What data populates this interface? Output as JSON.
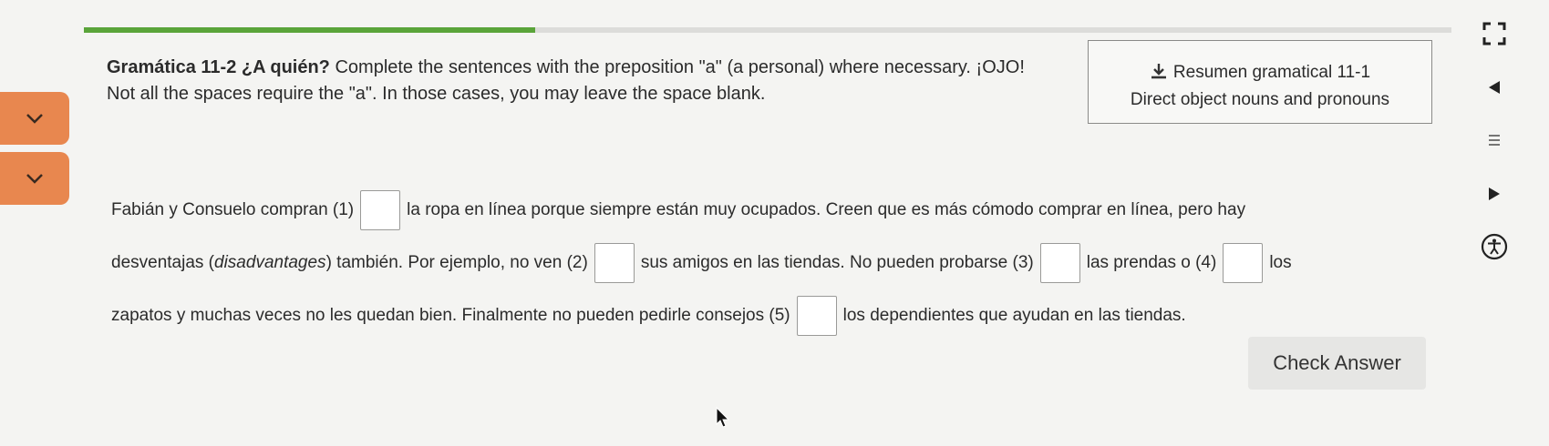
{
  "progress": {
    "value": 0.33,
    "fill_color": "#5aa43a"
  },
  "instructions": {
    "title": "Gramática 11-2 ¿A quién?",
    "line1_rest": " Complete the sentences with the preposition \"a\" (a personal) where necessary. ¡OJO!",
    "line2": "Not all the spaces require the \"a\". In those cases, you may leave the space blank."
  },
  "reference": {
    "icon": "download-icon",
    "line1": "Resumen gramatical 11-1",
    "line2": "Direct object nouns and pronouns"
  },
  "passage": {
    "seg0": "Fabián y Consuelo compran (1)",
    "seg1": "la ropa en línea porque siempre están muy ocupados. Creen que es más cómodo comprar en línea, pero hay",
    "seg2a": "desventajas (",
    "seg2b": "disadvantages",
    "seg2c": ") también. Por ejemplo, no ven (2)",
    "seg3": "sus amigos en las tiendas. No pueden probarse (3)",
    "seg4": "las prendas o (4)",
    "seg5": "los",
    "seg6": "zapatos y muchas veces no les quedan bien. Finalmente no pueden pedirle consejos (5)",
    "seg7": "los dependientes que ayudan en las tiendas."
  },
  "blanks": [
    "",
    "",
    "",
    "",
    ""
  ],
  "check_button": {
    "label": "Check Answer"
  },
  "side_tabs": [
    {
      "icon": "chevron-down-icon"
    },
    {
      "icon": "chevron-down-icon"
    }
  ],
  "right_rail": [
    {
      "icon": "fullscreen-icon"
    },
    {
      "icon": "triangle-left-icon"
    },
    {
      "icon": "menu-icon"
    },
    {
      "icon": "triangle-right-icon"
    },
    {
      "icon": "accessibility-icon"
    }
  ],
  "colors": {
    "accent_orange": "#e8874f",
    "progress_green": "#5aa43a"
  }
}
